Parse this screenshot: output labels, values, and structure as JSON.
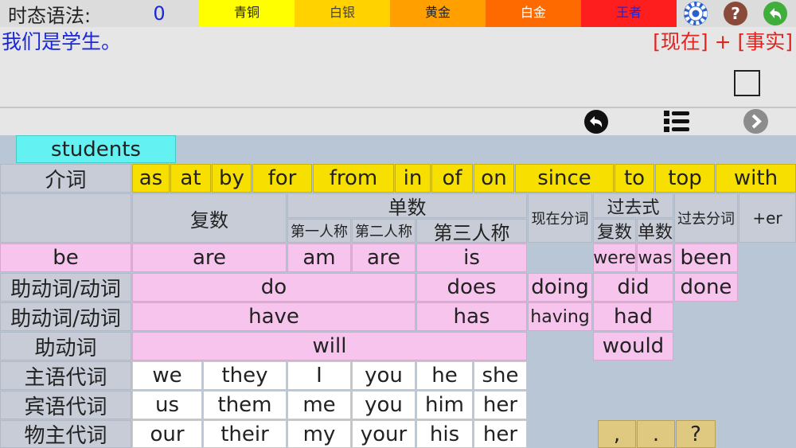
{
  "topbar": {
    "grammar_label": "时态语法:",
    "score": "0",
    "tiers": [
      {
        "label": "青铜",
        "color": "#ffff00",
        "text_color": "#222222"
      },
      {
        "label": "白银",
        "color": "#ffd200",
        "text_color": "#444444"
      },
      {
        "label": "黄金",
        "color": "#ffa000",
        "text_color": "#222222"
      },
      {
        "label": "白金",
        "color": "#ff6a00",
        "text_color": "#ffffff"
      },
      {
        "label": "王者",
        "color": "#ff1e1e",
        "text_color": "#1a28d9"
      }
    ],
    "icons": [
      "person-icon",
      "settings-gear-icon",
      "help-icon",
      "back-green-icon"
    ]
  },
  "sentence": "我们是学生。",
  "formula": "[现在] + [事实]",
  "toolbar": {
    "icons": [
      "undo-icon",
      "checklist-icon",
      "next-icon"
    ]
  },
  "selected_word": "students",
  "prepositions": {
    "label": "介词",
    "words": [
      "as",
      "at",
      "by",
      "for",
      "from",
      "in",
      "of",
      "on",
      "since",
      "to",
      "top",
      "with"
    ]
  },
  "headers": {
    "plural": "复数",
    "singular": "单数",
    "first_person": "第一人称",
    "second_person": "第二人称",
    "third_person": "第三人称",
    "present_participle": "现在分词",
    "past_tense": "过去式",
    "past_plural": "复数",
    "past_singular": "单数",
    "past_participle": "过去分词",
    "er": "+er"
  },
  "verb_rows": {
    "be": {
      "label": "be",
      "plural": "are",
      "first": "am",
      "second": "are",
      "third": "is",
      "past_plural": "were",
      "past_singular": "was",
      "past_participle": "been"
    },
    "do": {
      "label": "助动词/动词",
      "base": "do",
      "third": "does",
      "present_participle": "doing",
      "past": "did",
      "past_participle": "done"
    },
    "have": {
      "label": "助动词/动词",
      "base": "have",
      "third": "has",
      "present_participle": "having",
      "past": "had"
    },
    "will": {
      "label": "助动词",
      "base": "will",
      "past": "would"
    }
  },
  "pronouns": {
    "subject": {
      "label": "主语代词",
      "words": [
        "we",
        "they",
        "I",
        "you",
        "he",
        "she"
      ]
    },
    "object": {
      "label": "宾语代词",
      "words": [
        "us",
        "them",
        "me",
        "you",
        "him",
        "her"
      ]
    },
    "possessive": {
      "label": "物主代词",
      "words": [
        "our",
        "their",
        "my",
        "your",
        "his",
        "her"
      ]
    }
  },
  "punctuation": [
    ",",
    ".",
    "?"
  ]
}
